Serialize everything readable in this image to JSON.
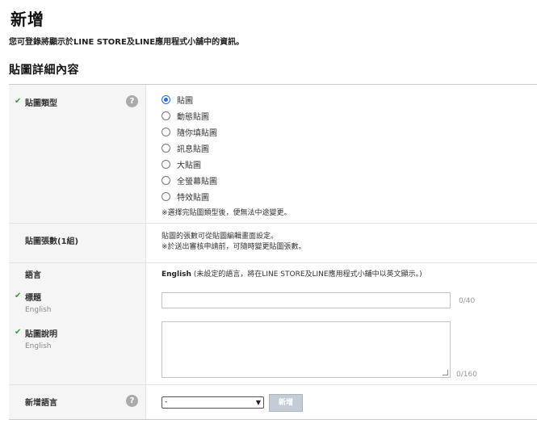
{
  "page": {
    "title": "新增",
    "description": "您可登錄將顯示於LINE STORE及LINE應用程式小舖中的資訊。",
    "section_title": "貼圖詳細內容"
  },
  "sticker_type": {
    "label": "貼圖類型",
    "help_icon": "?",
    "options": [
      "貼圖",
      "動態貼圖",
      "隨你填貼圖",
      "訊息貼圖",
      "大貼圖",
      "全螢幕貼圖",
      "特效貼圖"
    ],
    "selected_index": 0,
    "note": "※選擇完貼圖類型後，便無法中途變更。"
  },
  "sticker_count": {
    "label": "貼圖張數(1組)",
    "note_line1": "貼圖的張數可從貼圖編輯畫面設定。",
    "note_line2": "※於送出審核申請前，可隨時變更貼圖張數。"
  },
  "language": {
    "label": "語言",
    "value_bold": "English",
    "value_note": "(未設定的語言，將在LINE STORE及LINE應用程式小舖中以英文顯示。)"
  },
  "title_field": {
    "label": "標題",
    "sub_label": "English",
    "value": "",
    "counter": "0/40"
  },
  "desc_field": {
    "label": "貼圖說明",
    "sub_label": "English",
    "value": "",
    "counter": "0/160"
  },
  "add_language": {
    "label": "新增語言",
    "help_icon": "?",
    "select_value": "-",
    "button_label": "新增"
  },
  "colors": {
    "check": "#3a9c3a",
    "radio_selected": "#2a6fd6",
    "add_button": "#c4ccd6"
  }
}
